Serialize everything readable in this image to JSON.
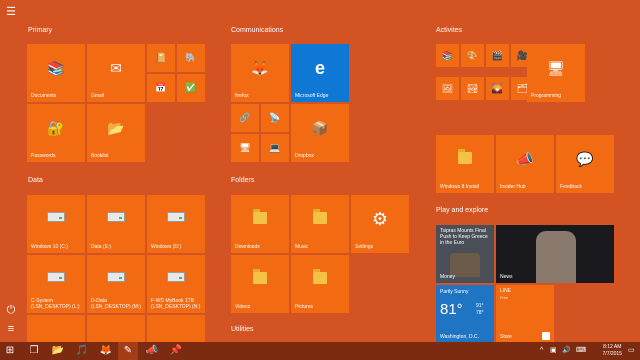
{
  "rail": {
    "menu_icon": "hamburger-icon",
    "power_icon": "power-icon",
    "apps_icon": "all-apps-icon"
  },
  "groups": {
    "primary": "Primary",
    "communications": "Communications",
    "activities": "Activites",
    "data": "Data",
    "folders": "Folders",
    "play": "Play and explore",
    "utilities": "Utilities"
  },
  "tiles": {
    "documents": "Documents",
    "gmail": "Gmail",
    "firefox": "firefox",
    "edge": "Microsoft Edge",
    "passwords": "Passwords",
    "booklist": "Booklist",
    "dropbox": "Dropbox",
    "programming": "Programming",
    "windows8": "Windows 8 Install",
    "insider": "Insider Hub",
    "feedback": "Feedback",
    "win10c": "Windows 10 (C:)",
    "data_e": "Data (E:)",
    "win_d": "Windows (D:)",
    "csystem": "C-System\n(LSN_DESKTOP) (L:)",
    "ddata": "D-Data\n(LSN_DESKTOP) (M:)",
    "fwd": "F-WD MyBook 1TB\n(LSN_DESKTOP) (N:)",
    "downloads": "Downloads",
    "music": "Music",
    "settings": "Settings",
    "videos": "Videos",
    "pictures": "Pictures",
    "money": "Money",
    "money_headline": "Tsipras Mounts Final Push to Keep Greece in the Euro",
    "news": "News",
    "weather_cond": "Partly Sunny",
    "weather_temp": "81°",
    "weather_hi": "91°",
    "weather_lo": "78°",
    "weather_city": "Washington, D.C.",
    "store": "Store",
    "store_app": "LINE",
    "store_price": "Free"
  },
  "taskbar": {
    "time": "8:12 AM",
    "date": "7/7/2015"
  },
  "colors": {
    "background": "#d35322",
    "tile": "#f26a12",
    "edge": "#0f78d4",
    "taskbar": "#7c2b10"
  }
}
